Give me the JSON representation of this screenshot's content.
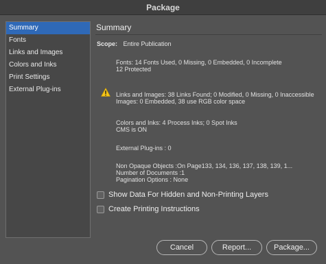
{
  "window": {
    "title": "Package"
  },
  "sidebar": {
    "items": [
      {
        "label": "Summary",
        "selected": true
      },
      {
        "label": "Fonts"
      },
      {
        "label": "Links and Images"
      },
      {
        "label": "Colors and Inks"
      },
      {
        "label": "Print Settings"
      },
      {
        "label": "External Plug-ins"
      }
    ]
  },
  "summary": {
    "title": "Summary",
    "scope_label": "Scope:",
    "scope_value": "Entire Publication",
    "fonts_line1": "Fonts: 14 Fonts Used, 0 Missing, 0 Embedded, 0 Incomplete",
    "fonts_line2": "12 Protected",
    "links_line1": "Links and Images: 38 Links Found; 0 Modified, 0 Missing, 0 Inaccessible",
    "links_line2": "Images: 0 Embedded, 38 use RGB color space",
    "colors_line1": "Colors and Inks: 4 Process Inks; 0 Spot Inks",
    "colors_line2": "CMS is ON",
    "plugins_line": "External Plug-ins : 0",
    "nonopaque_line1": "Non Opaque Objects :On Page133, 134, 136, 137, 138, 139, 1...",
    "nonopaque_line2": "Number of Documents :1",
    "nonopaque_line3": "Pagination Options : None"
  },
  "options": {
    "show_hidden_label": "Show Data For Hidden and Non-Printing Layers",
    "show_hidden_checked": false,
    "create_instructions_label": "Create Printing Instructions",
    "create_instructions_checked": false
  },
  "buttons": {
    "cancel": "Cancel",
    "report": "Report...",
    "package": "Package..."
  },
  "icons": {
    "warning": "warning-triangle-icon"
  },
  "colors": {
    "selection": "#2f69b7",
    "warning": "#f5c518",
    "background": "#535353"
  }
}
